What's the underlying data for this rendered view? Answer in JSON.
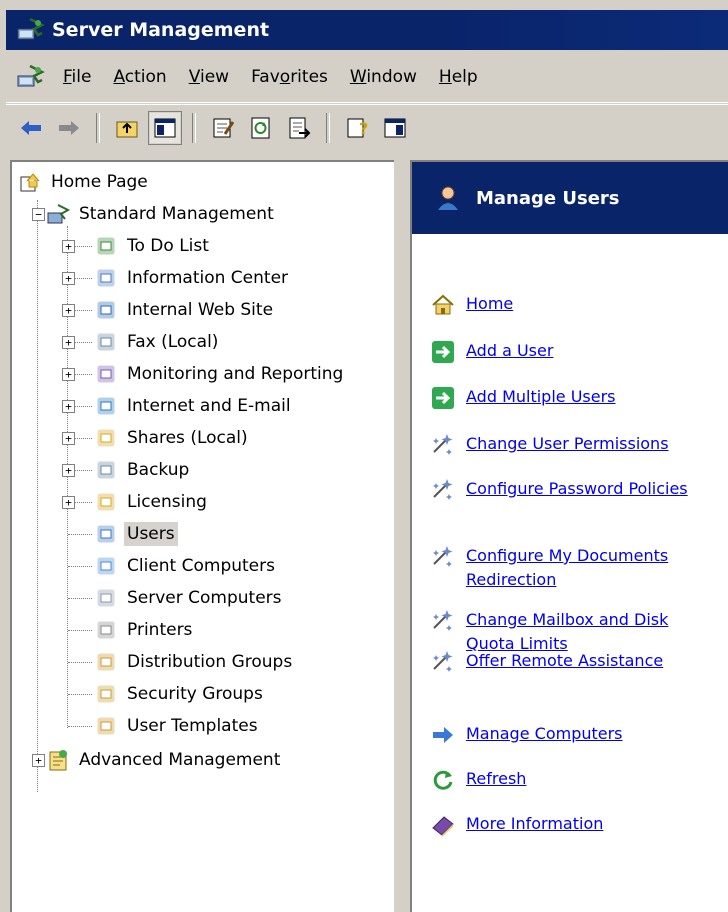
{
  "window": {
    "title": "Server Management"
  },
  "menu": [
    {
      "label": "File",
      "key": "F"
    },
    {
      "label": "Action",
      "key": "A"
    },
    {
      "label": "View",
      "key": "V"
    },
    {
      "label": "Favorites",
      "key": "o"
    },
    {
      "label": "Window",
      "key": "W"
    },
    {
      "label": "Help",
      "key": "H"
    }
  ],
  "toolbar": {
    "buttons": [
      "back-arrow-icon",
      "forward-arrow-icon",
      "up-one-level-icon",
      "show-hide-tree-icon",
      "properties-icon",
      "refresh-icon",
      "export-list-icon",
      "help-icon",
      "show-hide-action-pane-icon"
    ]
  },
  "tree": {
    "root": "Home Page",
    "standard": "Standard Management",
    "advanced": "Advanced Management",
    "items": [
      "To Do List",
      "Information Center",
      "Internal Web Site",
      "Fax (Local)",
      "Monitoring and Reporting",
      "Internet and E-mail",
      "Shares (Local)",
      "Backup",
      "Licensing",
      "Users",
      "Client Computers",
      "Server Computers",
      "Printers",
      "Distribution Groups",
      "Security Groups",
      "User Templates"
    ],
    "selected": "Users"
  },
  "taskpad": {
    "title": "Manage Users",
    "tasks": [
      {
        "label": "Home",
        "icon": "home-icon"
      },
      {
        "label": "Add a User",
        "icon": "green-arrow-icon"
      },
      {
        "label": "Add Multiple Users",
        "icon": "green-arrow-icon"
      },
      {
        "label": "Change User Permissions",
        "icon": "wizard-icon"
      },
      {
        "label": "Configure Password Policies",
        "icon": "wizard-icon"
      },
      {
        "label": "Configure My Documents Redirection",
        "icon": "wizard-icon"
      },
      {
        "label": "Change Mailbox and Disk Quota Limits",
        "icon": "wizard-icon"
      },
      {
        "label": "Offer Remote Assistance",
        "icon": "wizard-icon"
      },
      {
        "label": "Manage Computers",
        "icon": "blue-arrow-icon"
      },
      {
        "label": "Refresh",
        "icon": "refresh-icon"
      },
      {
        "label": "More Information",
        "icon": "book-icon"
      }
    ]
  },
  "colors": {
    "titlebar": "#0a246a",
    "link": "#0000ee",
    "chrome": "#d4d0c8"
  }
}
